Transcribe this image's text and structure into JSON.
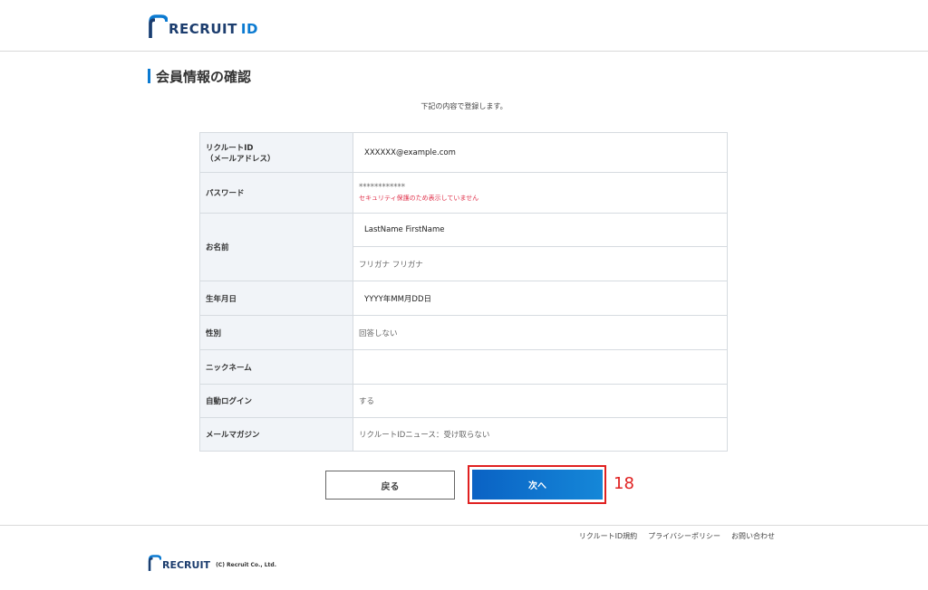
{
  "header": {
    "logo_text": "RECRUIT",
    "logo_suffix": "ID"
  },
  "page": {
    "title": "会員情報の確認",
    "intro": "下記の内容で登録します。"
  },
  "form": {
    "rows": [
      {
        "label_line1": "リクルートID",
        "label_line2": "（メールアドレス）",
        "value": "XXXXXX@example.com"
      },
      {
        "label": "パスワード",
        "value": "************",
        "note": "セキュリティ保護のため表示していません"
      },
      {
        "label": "お名前",
        "value": "LastName  FirstName",
        "value2": "フリガナ  フリガナ"
      },
      {
        "label": "生年月日",
        "value": "YYYY年MM月DD日"
      },
      {
        "label": "性別",
        "value": "回答しない"
      },
      {
        "label": "ニックネーム",
        "value": ""
      },
      {
        "label": "自動ログイン",
        "value": "する"
      },
      {
        "label": "メールマガジン",
        "value": "リクルートIDニュース：受け取らない"
      }
    ]
  },
  "buttons": {
    "back": "戻る",
    "next": "次へ"
  },
  "annotation": {
    "step": "18"
  },
  "footer": {
    "links": [
      "リクルートID規約",
      "プライバシーポリシー",
      "お問い合わせ"
    ],
    "brand": "RECRUIT",
    "copyright": "(C) Recruit Co., Ltd."
  },
  "colors": {
    "brand_blue": "#0b7ad1",
    "brand_navy": "#1c3d6e",
    "warning_red": "#e0334c",
    "highlight_red": "#e02020"
  }
}
